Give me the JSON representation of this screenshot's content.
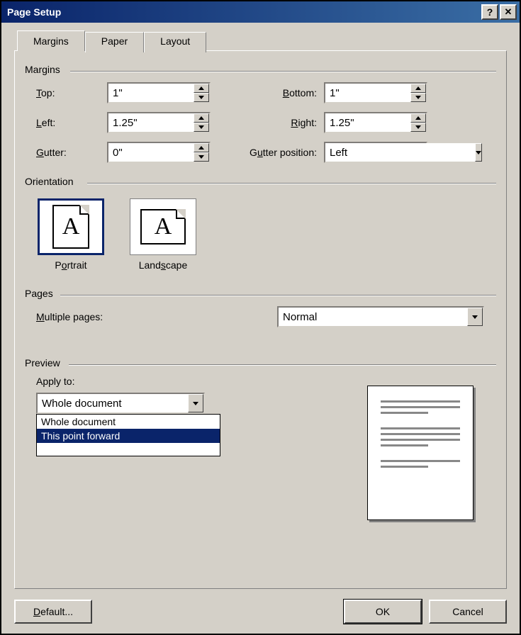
{
  "window": {
    "title": "Page Setup"
  },
  "tabs": {
    "margins": "Margins",
    "paper": "Paper",
    "layout": "Layout",
    "active": "margins"
  },
  "margins": {
    "legend": "Margins",
    "top_label": "Top:",
    "top_value": "1\"",
    "bottom_label": "Bottom:",
    "bottom_value": "1\"",
    "left_label": "Left:",
    "left_value": "1.25\"",
    "right_label": "Right:",
    "right_value": "1.25\"",
    "gutter_label": "Gutter:",
    "gutter_value": "0\"",
    "gutterpos_label": "Gutter position:",
    "gutterpos_value": "Left"
  },
  "orientation": {
    "legend": "Orientation",
    "portrait_label": "Portrait",
    "landscape_label": "Landscape",
    "selected": "portrait"
  },
  "pages": {
    "legend": "Pages",
    "multiple_label": "Multiple pages:",
    "multiple_value": "Normal"
  },
  "preview": {
    "legend": "Preview",
    "applyto_label": "Apply to:",
    "applyto_value": "Whole document",
    "options": [
      "Whole document",
      "This point forward"
    ],
    "highlight_index": 1
  },
  "buttons": {
    "default": "Default...",
    "ok": "OK",
    "cancel": "Cancel"
  }
}
